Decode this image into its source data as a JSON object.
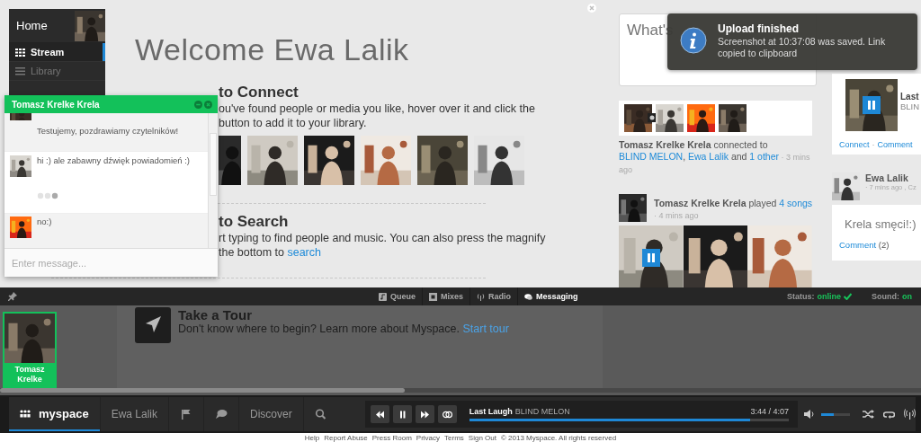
{
  "sidebar": {
    "home": "Home",
    "items": [
      {
        "label": "Stream",
        "selected": true
      },
      {
        "label": "Library",
        "selected": false
      }
    ]
  },
  "welcome": {
    "title": "Welcome Ewa Lalik",
    "sections": [
      {
        "kind": "connect",
        "heading": "to Connect",
        "lines": [
          {
            "text": "ou've found people or media you like, hover over it and click the"
          },
          {
            "text": "button to add it to your library."
          }
        ],
        "photos": [
          {
            "kind": "picture"
          },
          {
            "kind": "picture"
          },
          {
            "kind": "picture"
          },
          {
            "kind": "picture"
          },
          {
            "kind": "picture"
          },
          {
            "kind": "picture"
          }
        ]
      },
      {
        "kind": "search",
        "heading": "to Search",
        "lines": [
          {
            "text": "rt typing to find people and music. You can also press the magnify"
          },
          {
            "text": "the bottom to",
            "link": "search"
          }
        ]
      }
    ]
  },
  "chat": {
    "title": "Tomasz Krelke Krela",
    "messages": [
      {
        "text": "Testujemy, pozdrawiamy czytelników!",
        "typing": false
      },
      {
        "text": "hi :) ale zabawny dźwięk powiadomień :)",
        "typing": true
      },
      {
        "text": "no:)",
        "typing": false
      }
    ],
    "placeholder": "Enter message..."
  },
  "composer": {
    "placeholder": "What's"
  },
  "notification": {
    "title": "Upload finished",
    "text": "Screenshot at 10:37:08 was saved. Link copied to clipboard"
  },
  "feed": [
    {
      "kind": "connect",
      "thumbs": [
        {
          "hovered": true
        },
        {
          "hovered": false
        },
        {
          "hovered": false
        },
        {
          "hovered": false
        }
      ],
      "parts": [
        {
          "text": "Tomasz Krelke Krela",
          "kind": "name"
        },
        {
          "text": " connected to "
        },
        {
          "text": "BLIND MELON",
          "kind": "link"
        },
        {
          "text": ", "
        },
        {
          "text": "Ewa Lalik",
          "kind": "link"
        },
        {
          "text": " and "
        },
        {
          "text": "1 other",
          "kind": "link"
        },
        {
          "text": " · 3 mins ago",
          "kind": "time"
        }
      ]
    },
    {
      "kind": "played",
      "parts": [
        {
          "text": "Tomasz Krelke Krela",
          "kind": "name"
        },
        {
          "text": " played "
        },
        {
          "text": "4 songs",
          "kind": "link"
        }
      ],
      "time": "· 4 mins ago",
      "albums": [
        {
          "playing": true
        },
        {
          "playing": false
        },
        {
          "playing": false
        }
      ]
    }
  ],
  "feed_right": {
    "track_card": {
      "playing": true,
      "title": "Last",
      "artist": "BLIN",
      "actions": [
        "Connect",
        "Comment"
      ],
      "separator": "·"
    },
    "post": {
      "author": "Ewa Lalik",
      "time": "· 7 mins ago , Cz",
      "text": "Krela smęci!:)",
      "comment": "Comment",
      "count": "(2)"
    }
  },
  "messaging_bar": {
    "tabs": [
      {
        "label": "Queue",
        "selected": false
      },
      {
        "label": "Mixes",
        "selected": false
      },
      {
        "label": "Radio",
        "selected": false
      },
      {
        "label": "Messaging",
        "selected": true
      }
    ],
    "status_label": "Status:",
    "status": "online",
    "online": true,
    "sound_label": "Sound:",
    "sound": "on"
  },
  "tour": {
    "heading": "Take a Tour",
    "text": "Don't know where to begin? Learn more about Myspace.",
    "link": "Start tour"
  },
  "chat_tray": [
    {
      "name": "Tomasz Krelke",
      "selected": true
    }
  ],
  "player": {
    "brand": "myspace",
    "user": "Ewa Lalik",
    "discover": "Discover",
    "track": {
      "title": "Last Laugh",
      "artist": "BLIND MELON",
      "time": "3:44 / 4:07",
      "level": 0.88,
      "playing": true
    },
    "volume": {
      "level": 0.45
    }
  },
  "footer": {
    "links": [
      "Help",
      "Report Abuse",
      "Press Room",
      "Privacy",
      "Terms",
      "Sign Out"
    ],
    "copyright": "© 2013 Myspace. All rights reserved"
  }
}
